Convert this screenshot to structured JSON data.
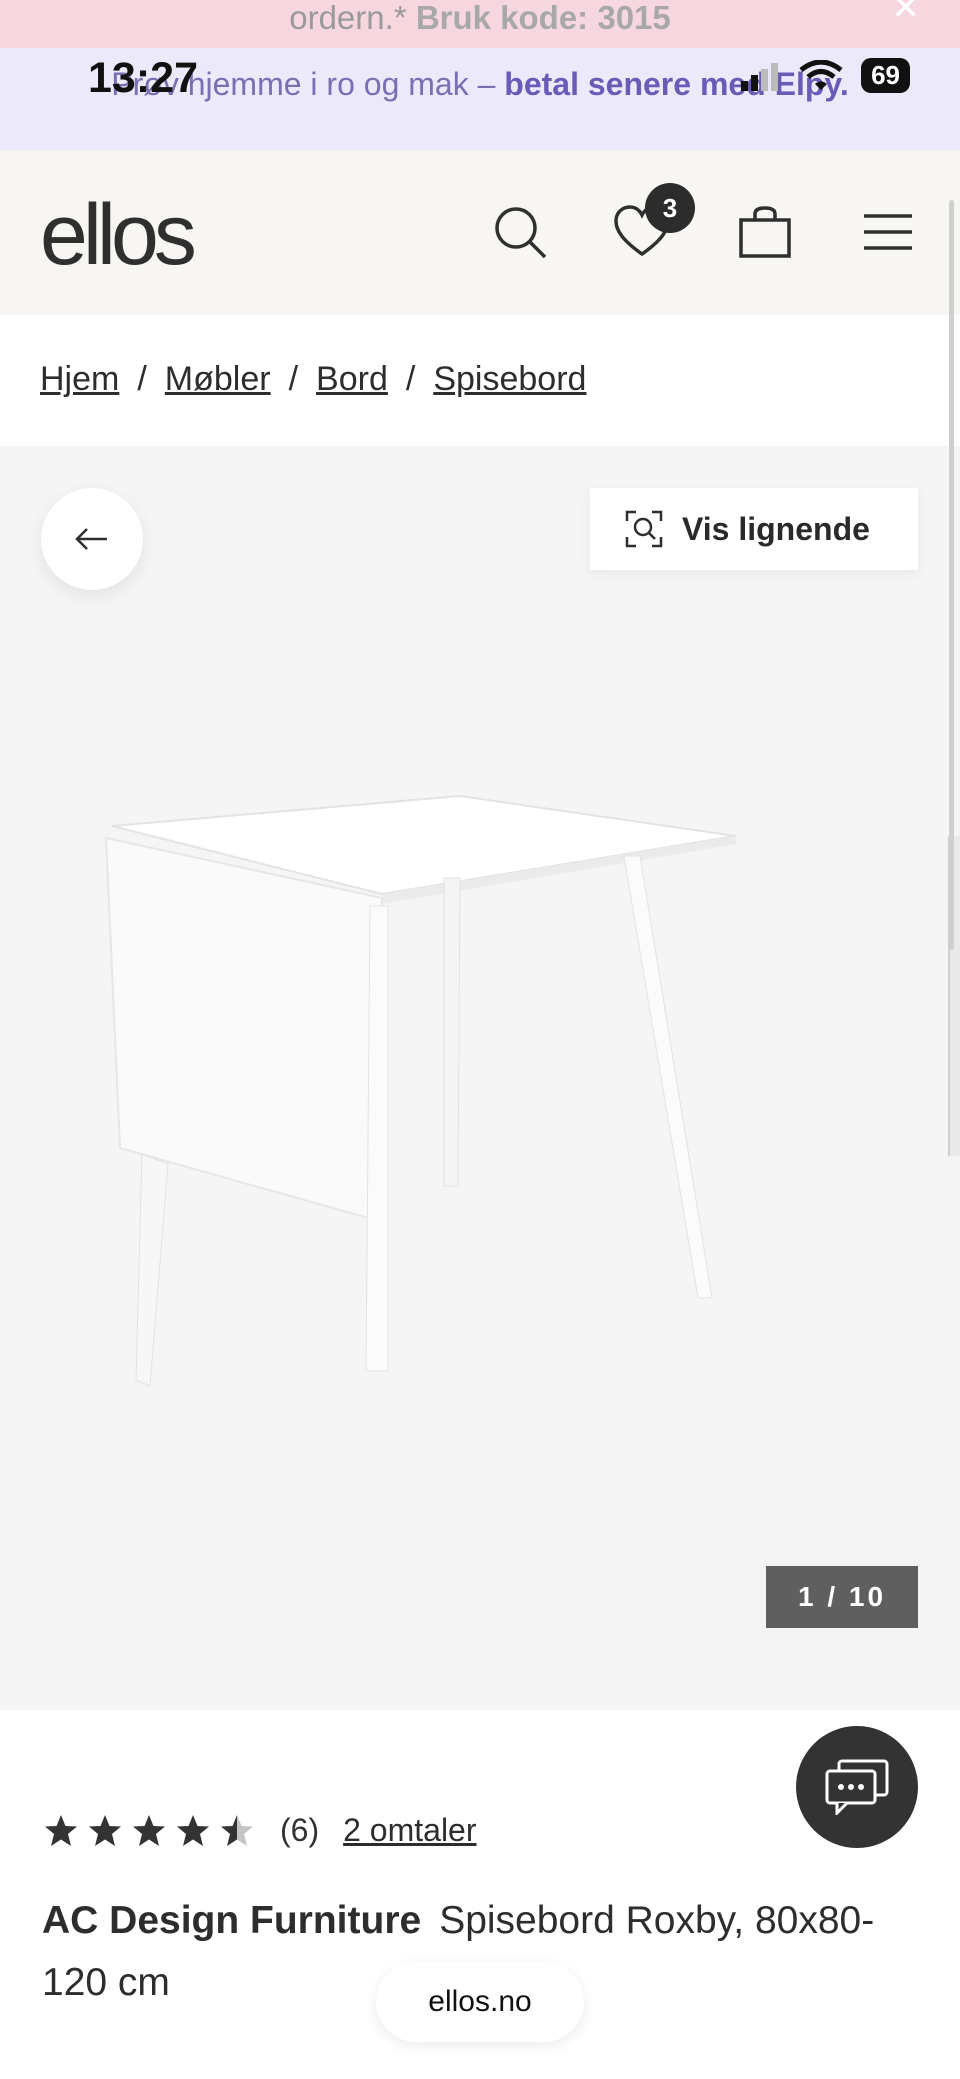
{
  "promo": {
    "line1_text": "ordern.* ",
    "line1_bold": "Bruk kode: 3015",
    "line2_text": "Prøv hjemme i ro og mak – ",
    "line2_bold": "betal senere med Elpy."
  },
  "status_bar": {
    "time": "13:27",
    "battery": "69"
  },
  "header": {
    "logo": "ellos",
    "wishlist_count": "3"
  },
  "breadcrumb": [
    "Hjem",
    "Møbler",
    "Bord",
    "Spisebord"
  ],
  "gallery": {
    "similar_label": "Vis lignende",
    "counter": "1 / 10"
  },
  "product": {
    "rating": 4.5,
    "rating_count": "(6)",
    "reviews_link": "2 omtaler",
    "brand": "AC Design Furniture",
    "name": "Spisebord Roxby, 80x80-120 cm"
  },
  "browser": {
    "url": "ellos.no"
  },
  "colors": {
    "accent_purple": "#6a5bb6",
    "promo_pink": "#f7d7df",
    "header_bg": "#f8f6f2"
  }
}
